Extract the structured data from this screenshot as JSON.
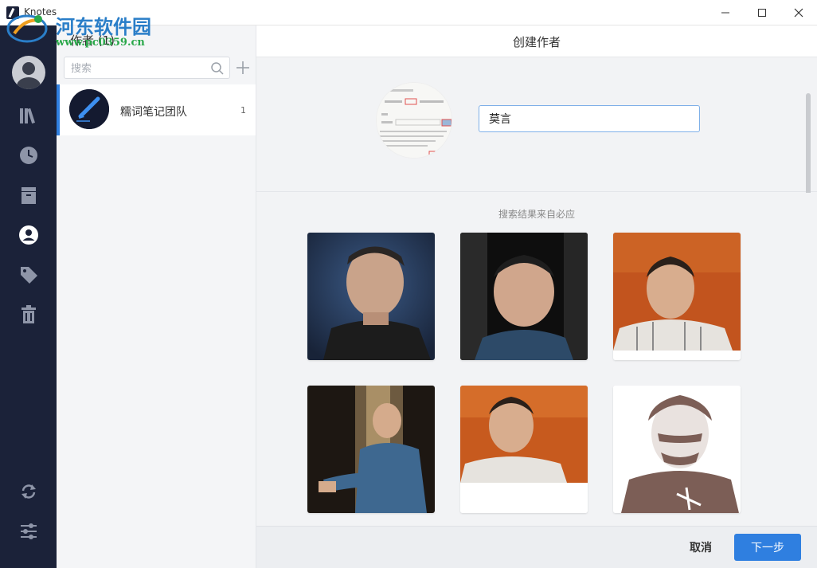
{
  "window": {
    "title": "Knotes",
    "watermark_text": "河东软件园",
    "watermark_url": "www.pc0359.cn"
  },
  "nav_rail": {
    "items": [
      {
        "icon": "library-icon",
        "active": false
      },
      {
        "icon": "clock-icon",
        "active": false
      },
      {
        "icon": "archive-icon",
        "active": false
      },
      {
        "icon": "author-icon",
        "active": true
      },
      {
        "icon": "tag-icon",
        "active": false
      },
      {
        "icon": "trash-icon",
        "active": false
      },
      {
        "icon": "sync-icon",
        "active": false
      },
      {
        "icon": "settings-sliders-icon",
        "active": false
      }
    ]
  },
  "author_list": {
    "header": "作者 (1)",
    "search_placeholder": "搜索",
    "items": [
      {
        "name": "糯词笔记团队",
        "count": "1",
        "selected": true
      }
    ]
  },
  "main": {
    "title": "创建作者",
    "name_input_value": "莫言",
    "results_caption": "搜索结果来自必应",
    "result_images": [
      {
        "subject": "portrait-dark-blue-background"
      },
      {
        "subject": "portrait-black-background"
      },
      {
        "subject": "portrait-orange-background"
      },
      {
        "subject": "portrait-seated-window"
      },
      {
        "subject": "portrait-orange-calligraphy"
      },
      {
        "subject": "portrait-brown-illustration"
      }
    ]
  },
  "footer": {
    "cancel_label": "取消",
    "next_label": "下一步"
  },
  "colors": {
    "rail_bg": "#1b2239",
    "accent": "#2f7fe0",
    "panel_bg": "#f2f3f5"
  }
}
